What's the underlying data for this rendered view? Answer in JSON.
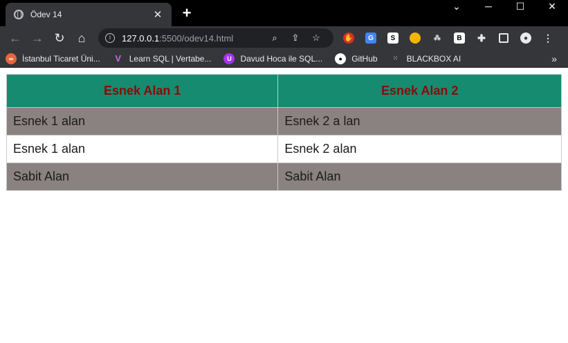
{
  "browser": {
    "tab_title": "Ödev 14",
    "tab_close": "✕",
    "new_tab": "+",
    "window_controls": {
      "minimize": "─",
      "maximize": "☐",
      "close": "✕",
      "dropdown": "⌄"
    },
    "nav": {
      "back": "←",
      "forward": "→",
      "reload": "↻",
      "home": "⌂"
    },
    "url_host": "127.0.0.1",
    "url_path": ":5500/odev14.html",
    "bookmarks": [
      {
        "label": "İstanbul Ticaret Üni...",
        "icon": "istanbul-ticaret-icon",
        "color": "#e8663d"
      },
      {
        "label": "Learn SQL | Vertabe...",
        "icon": "vertabelo-icon",
        "color": "#7b3fc4"
      },
      {
        "label": "Davud Hoca ile SQL...",
        "icon": "udemy-icon",
        "color": "#a435f0"
      },
      {
        "label": "GitHub",
        "icon": "github-icon",
        "color": "#ffffff"
      },
      {
        "label": "BLACKBOX AI",
        "icon": "blackbox-icon",
        "color": "#888888"
      }
    ],
    "bookmarks_more": "»"
  },
  "table": {
    "headers": [
      "Esnek Alan 1",
      "Esnek Alan 2"
    ],
    "rows": [
      [
        "Esnek 1 alan",
        "Esnek 2 a lan"
      ],
      [
        "Esnek 1 alan",
        "Esnek 2 alan"
      ],
      [
        "Sabit Alan",
        "Sabit Alan"
      ]
    ]
  },
  "colors": {
    "header_bg": "#178b6f",
    "header_text": "#8b0a0a",
    "grey_row": "#8a8281"
  }
}
